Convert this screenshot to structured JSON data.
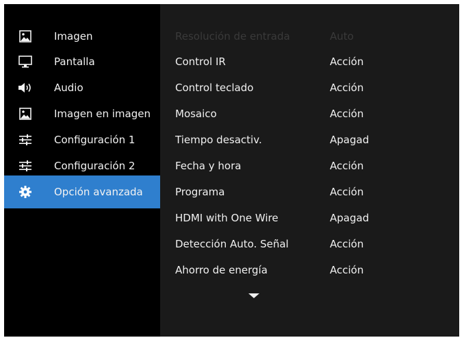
{
  "sidebar": {
    "items": [
      {
        "label": "Imagen",
        "icon": "picture-icon"
      },
      {
        "label": "Pantalla",
        "icon": "monitor-icon"
      },
      {
        "label": "Audio",
        "icon": "speaker-icon"
      },
      {
        "label": "Imagen en imagen",
        "icon": "pip-picture-icon"
      },
      {
        "label": "Configuración 1",
        "icon": "sliders-icon"
      },
      {
        "label": "Configuración 2",
        "icon": "sliders-icon"
      },
      {
        "label": "Opción avanzada",
        "icon": "gear-icon",
        "selected": true
      }
    ]
  },
  "main": {
    "rows": [
      {
        "name": "Resolución de entrada",
        "value": "Auto",
        "disabled": true
      },
      {
        "name": "Control IR",
        "value": "Acción"
      },
      {
        "name": "Control teclado",
        "value": "Acción"
      },
      {
        "name": "Mosaico",
        "value": "Acción"
      },
      {
        "name": "Tiempo desactiv.",
        "value": "Apagad"
      },
      {
        "name": "Fecha y hora",
        "value": "Acción"
      },
      {
        "name": "Programa",
        "value": "Acción"
      },
      {
        "name": "HDMI with One Wire",
        "value": "Apagad"
      },
      {
        "name": "Detección Auto. Señal",
        "value": "Acción"
      },
      {
        "name": "Ahorro de energía",
        "value": "Acción"
      }
    ],
    "scroll_indicator": "scroll-down-arrow-icon"
  },
  "colors": {
    "accent": "#2f7fce",
    "sidebar_bg": "#000000",
    "main_bg": "#1a1a1a",
    "text": "#f0f0f0",
    "disabled_text": "#3a3a3a"
  }
}
